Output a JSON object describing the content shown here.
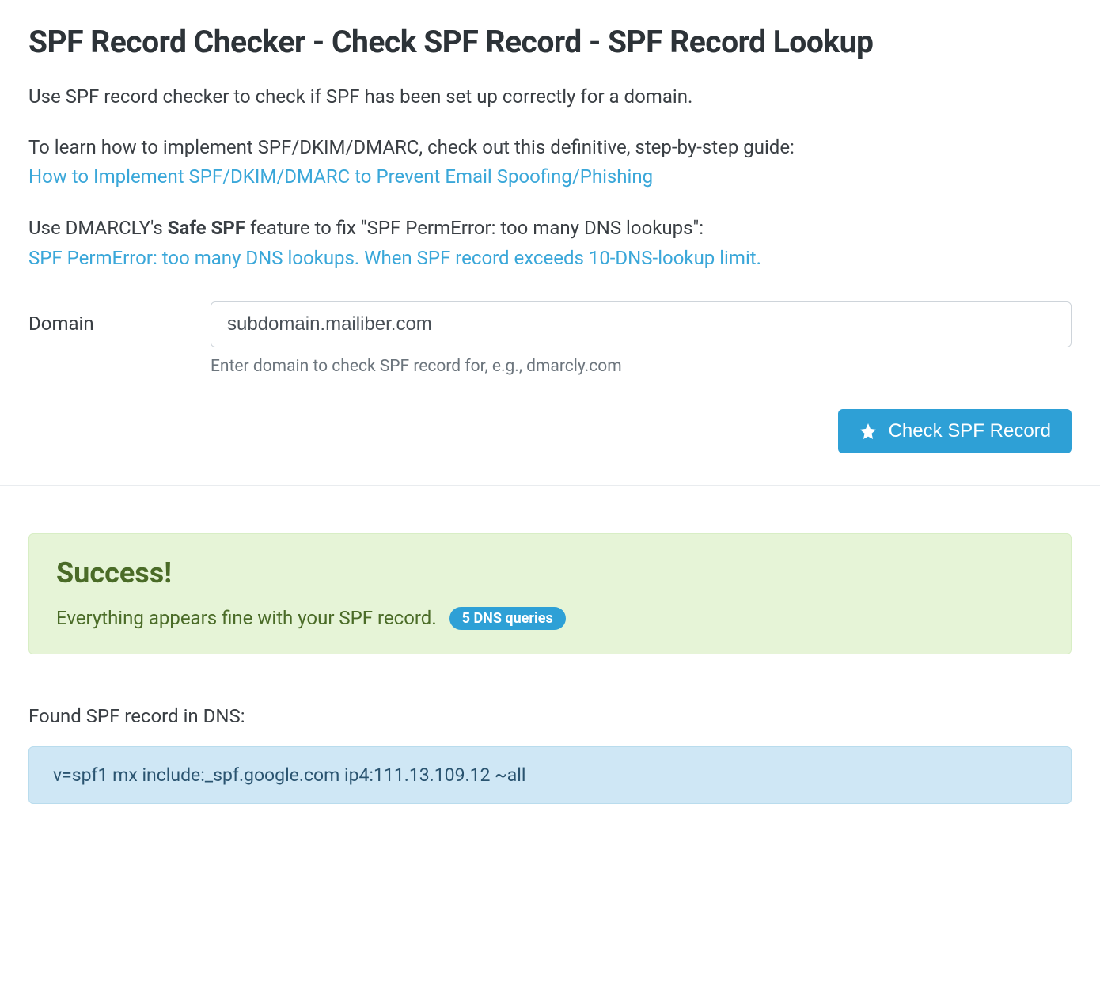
{
  "header": {
    "title": "SPF Record Checker - Check SPF Record - SPF Record Lookup"
  },
  "intro": "Use SPF record checker to check if SPF has been set up correctly for a domain.",
  "guide": {
    "lead": "To learn how to implement SPF/DKIM/DMARC, check out this definitive, step-by-step guide:",
    "link_text": "How to Implement SPF/DKIM/DMARC to Prevent Email Spoofing/Phishing"
  },
  "safespf": {
    "lead_pre": "Use DMARCLY's ",
    "strong": "Safe SPF",
    "lead_post": " feature to fix \"SPF PermError: too many DNS lookups\":",
    "link_text": "SPF PermError: too many DNS lookups. When SPF record exceeds 10-DNS-lookup limit."
  },
  "form": {
    "label": "Domain",
    "value": "subdomain.mailiber.com",
    "helper": "Enter domain to check SPF record for, e.g., dmarcly.com",
    "button_label": "Check SPF Record"
  },
  "result": {
    "success_title": "Success!",
    "success_msg": "Everything appears fine with your SPF record.",
    "dns_badge": "5 DNS queries",
    "found_label": "Found SPF record in DNS:",
    "spf_record": "v=spf1 mx include:_spf.google.com ip4:111.13.109.12 ~all"
  }
}
